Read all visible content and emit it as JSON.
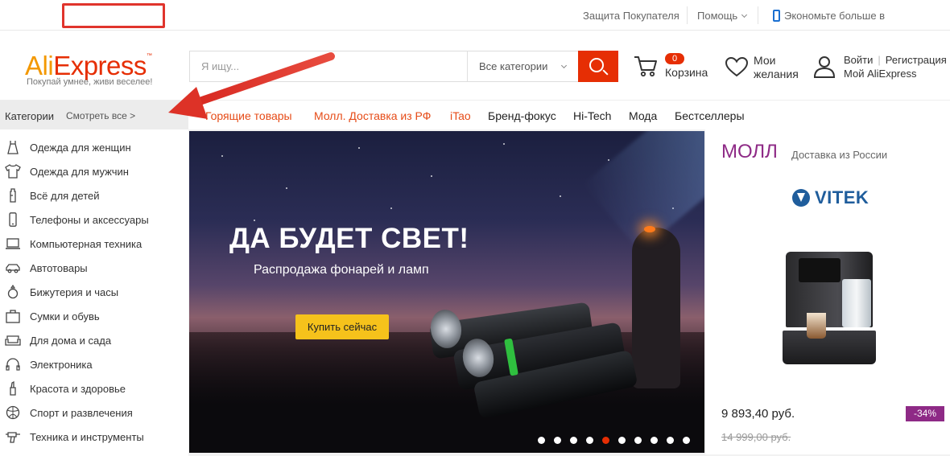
{
  "topbar": {
    "buyer_protection": "Защита Покупателя",
    "help": "Помощь",
    "app_promo": "Экономьте больше в приложении!"
  },
  "header": {
    "logo_ali": "Ali",
    "logo_express": "Express",
    "slogan": "Покупай умнее, живи веселее!",
    "search": {
      "placeholder": "Я ищу...",
      "category": "Все категории"
    },
    "cart": {
      "count": "0",
      "label": "Корзина"
    },
    "wishlist": {
      "line1": "Мои",
      "line2": "желания"
    },
    "account": {
      "login": "Войти",
      "register": "Регистрация",
      "my": "Мой AliExpress"
    }
  },
  "catnav": {
    "categories_label": "Категории",
    "see_all": "Смотреть все >",
    "links": [
      {
        "label": "Горящие товары",
        "hot": true
      },
      {
        "label": "Молл. Доставка из РФ",
        "hot": true
      },
      {
        "label": "iTao",
        "hot": true
      },
      {
        "label": "Бренд-фокус",
        "hot": false
      },
      {
        "label": "Hi-Tech",
        "hot": false
      },
      {
        "label": "Мода",
        "hot": false
      },
      {
        "label": "Бестселлеры",
        "hot": false
      }
    ]
  },
  "sidebar": {
    "items": [
      {
        "label": "Одежда для женщин",
        "icon": "dress-icon"
      },
      {
        "label": "Одежда для мужчин",
        "icon": "shirt-icon"
      },
      {
        "label": "Всё для детей",
        "icon": "baby-bottle-icon"
      },
      {
        "label": "Телефоны и аксессуары",
        "icon": "phone-icon"
      },
      {
        "label": "Компьютерная техника",
        "icon": "laptop-icon"
      },
      {
        "label": "Автотовары",
        "icon": "car-icon"
      },
      {
        "label": "Бижутерия и часы",
        "icon": "ring-icon"
      },
      {
        "label": "Сумки и обувь",
        "icon": "bag-icon"
      },
      {
        "label": "Для дома и сада",
        "icon": "sofa-icon"
      },
      {
        "label": "Электроника",
        "icon": "headphones-icon"
      },
      {
        "label": "Красота и здоровье",
        "icon": "lipstick-icon"
      },
      {
        "label": "Спорт и развлечения",
        "icon": "ball-icon"
      },
      {
        "label": "Техника и инструменты",
        "icon": "drill-icon"
      }
    ]
  },
  "banner": {
    "title": "ДА БУДЕТ СВЕТ!",
    "subtitle": "Распродажа фонарей и ламп",
    "button": "Купить сейчас",
    "slides_total": 10,
    "active_slide": 4
  },
  "mall": {
    "title": "МОЛЛ",
    "subtitle": "Доставка из России",
    "brand": "VITEK",
    "price": "9 893,40 руб.",
    "old_price": "14 999,00 руб.",
    "discount": "-34%"
  },
  "colors": {
    "accent": "#e62e04",
    "logo_orange": "#f39800",
    "hot_link": "#e64b17",
    "mall_purple": "#8e2a86",
    "buy_button": "#f6c21b",
    "annotation": "#e0342c"
  }
}
